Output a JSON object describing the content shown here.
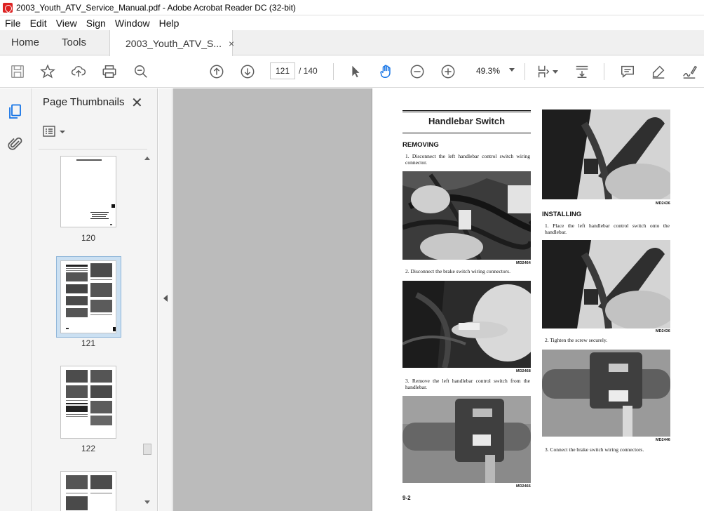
{
  "window": {
    "title": "2003_Youth_ATV_Service_Manual.pdf - Adobe Acrobat Reader DC (32-bit)"
  },
  "menu": [
    "File",
    "Edit",
    "View",
    "Sign",
    "Window",
    "Help"
  ],
  "tabs": {
    "home": "Home",
    "tools": "Tools",
    "document": "2003_Youth_ATV_S...",
    "close": "×"
  },
  "toolbar": {
    "page_current": "121",
    "page_total": "/ 140",
    "zoom": "49.3%"
  },
  "icons": {
    "save": "save-icon",
    "bookmark": "star-icon",
    "upload": "upload-icon",
    "print": "print-icon",
    "find": "zoom-search-icon",
    "prev_page": "arrow-up-circle-icon",
    "next_page": "arrow-down-circle-icon",
    "select": "pointer-icon",
    "hand": "hand-icon",
    "zoom_out": "minus-circle-icon",
    "zoom_in": "plus-circle-icon",
    "fit": "page-fit-icon",
    "scroll": "scroll-mode-icon",
    "comment": "comment-icon",
    "highlight": "highlight-icon",
    "sign": "sign-icon"
  },
  "sidebar": {
    "title": "Page Thumbnails",
    "close": "✕",
    "thumbnails": [
      {
        "label": "120"
      },
      {
        "label": "121",
        "selected": true
      },
      {
        "label": "122"
      }
    ]
  },
  "document": {
    "section_title": "Handlebar Switch",
    "removing_heading": "REMOVING",
    "installing_heading": "INSTALLING",
    "steps_removing": [
      "1. Disconnect the left handlebar control switch wiring connector.",
      "2. Disconnect the brake switch wiring connectors.",
      "3. Remove the left handlebar control switch from the handlebar."
    ],
    "steps_installing": [
      "1. Place the left handlebar control switch onto the handlebar.",
      "2. Tighten the screw securely.",
      "3. Connect the brake switch wiring connectors."
    ],
    "photo_codes": [
      "MD2464",
      "MD2468",
      "MD2466",
      "MD2436",
      "MD2436",
      "MD2446"
    ],
    "page_number": "9-2"
  },
  "colors": {
    "accent": "#1473e6",
    "doc_background": "#bbbbbb",
    "panel_background": "#f4f4f4"
  }
}
